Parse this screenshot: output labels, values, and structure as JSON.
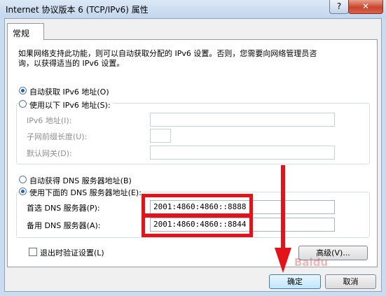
{
  "window": {
    "title": "Internet 协议版本 6 (TCP/IPv6) 属性",
    "help_label": "?",
    "close_label": "✕"
  },
  "tab": {
    "label": "常规"
  },
  "description": {
    "line1": "如果网络支持此功能，则可以自动获取分配的 IPv6 设置。否则，您需要向网络管理员咨",
    "line2": "询，以获得适当的 IPv6 设置。"
  },
  "ip_section": {
    "auto_option": "自动获取 IPv6 地址(O)",
    "auto_selected": true,
    "manual_option": "使用以下 IPv6 地址(S):",
    "ipv6_address_label": "IPv6 地址(I):",
    "ipv6_address_value": "",
    "prefix_length_label": "子网前缀长度(U):",
    "prefix_length_value": "",
    "gateway_label": "默认网关(D):",
    "gateway_value": ""
  },
  "dns_section": {
    "auto_option": "自动获得 DNS 服务器地址(B)",
    "manual_option": "使用下面的 DNS 服务器地址(E):",
    "manual_selected": true,
    "preferred_label": "首选 DNS 服务器(P):",
    "preferred_value": "2001:4860:4860::8888",
    "alternate_label": "备用 DNS 服务器(A):",
    "alternate_value": "2001:4860:4860::8844"
  },
  "validate_label": "退出时验证设置(L)",
  "validate_checked": false,
  "buttons": {
    "advanced": "高级(V)...",
    "ok": "确定",
    "cancel": "取消"
  },
  "colors": {
    "highlight": "#e3131a",
    "accent": "#1f5fbf"
  },
  "watermark": "Baidu"
}
